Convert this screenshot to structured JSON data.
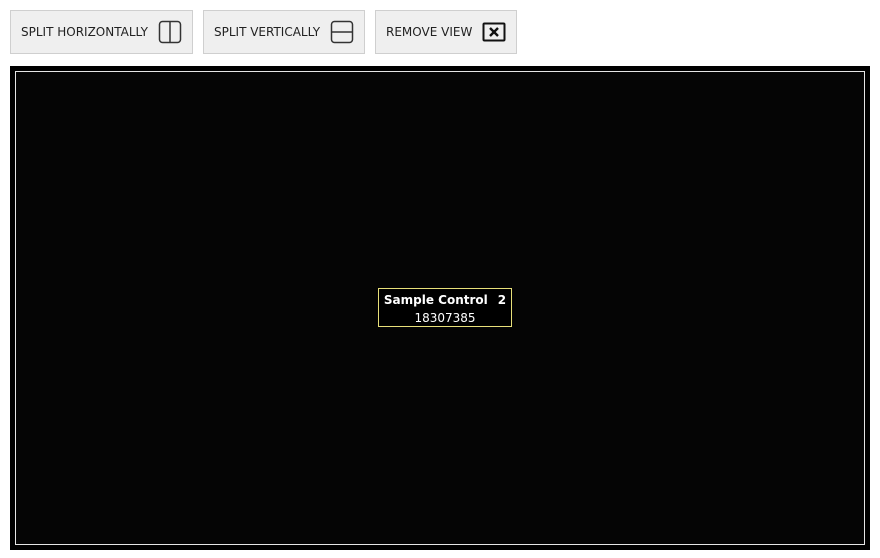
{
  "toolbar": {
    "split_horizontally": {
      "label": "SPLIT HORIZONTALLY",
      "icon": "split-horizontal-icon"
    },
    "split_vertically": {
      "label": "SPLIT VERTICALLY",
      "icon": "split-vertical-icon"
    },
    "remove_view": {
      "label": "REMOVE VIEW",
      "icon": "close-box-icon"
    }
  },
  "view": {
    "background_color": "#000000",
    "control": {
      "title": "Sample Control",
      "index": "2",
      "value": "18307385",
      "border_color": "#e8e07a"
    }
  }
}
